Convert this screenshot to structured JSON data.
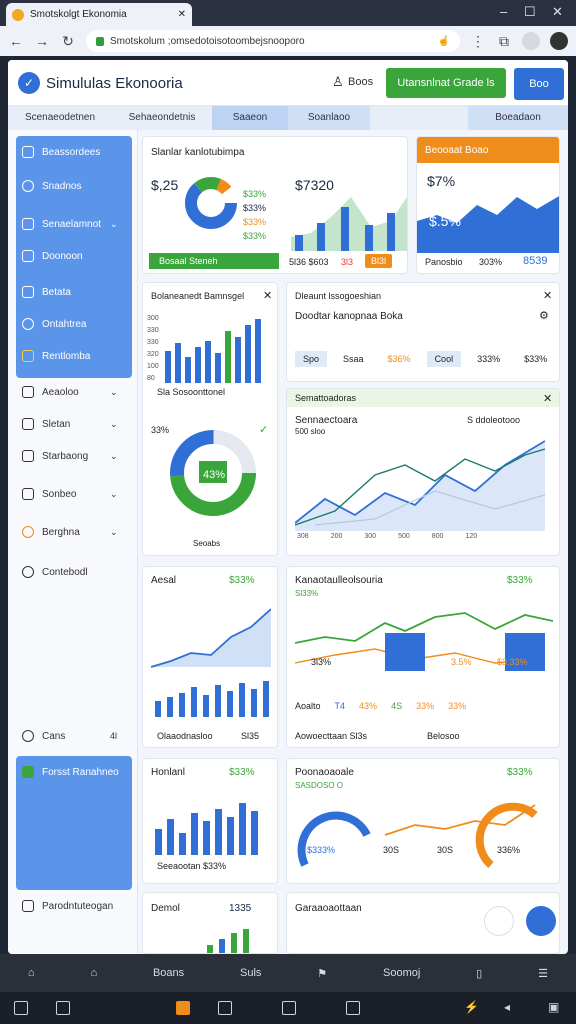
{
  "browser": {
    "tab_title": "Smotskolgt Ekonomia",
    "url": "Smotskolum ;omsedotoisotoombejsnooporo"
  },
  "app": {
    "title": "Simululas Ekonooria",
    "header_label": "Boos",
    "green_button": "Utansnlnat Grade ls",
    "blue_button": "Boo",
    "accent": "#2f6fd6",
    "green": "#3aa53a",
    "orange": "#f08c1a"
  },
  "subnav": [
    "Scenaeodetnen",
    "Sehaeondetnis",
    "Saaeon",
    "Soanlaoo",
    "",
    "Boeadaon"
  ],
  "sidebar": {
    "items": [
      "Beassordees",
      "Snadnos",
      "Senaelamnot",
      "Doonoon",
      "Betata",
      "Ontahtrea",
      "Rentlomba"
    ],
    "items2": [
      "Aeaoloo",
      "Sletan",
      "Starbaong",
      "Sonbeo",
      "Berghna",
      "Contebodl"
    ],
    "footer": "Cans",
    "footer_right": "4l",
    "panel2": "Forsst Ranahneo",
    "panel3": "Parodntuteogan"
  },
  "card1": {
    "title": "Slanlar kanlotubimpa",
    "v1": "$,25",
    "lines": [
      "$33%",
      "$33%",
      "$33%",
      "$33%"
    ],
    "v2": "$7320",
    "bar_label": "Bosaal Steneh",
    "foot1": "5l36 $603",
    "foot2": "3l3",
    "foot3": "Bl3l"
  },
  "card2": {
    "title": "Beooaat Boao",
    "v1": "$7%",
    "v2": "$.5%",
    "foot1": "Panosbio",
    "foot2": "303%",
    "foot3": "8539"
  },
  "card3": {
    "title": "Bolaneanedt Bamnsgel",
    "axis": [
      "300",
      "330",
      "330",
      "320",
      "100",
      "80"
    ],
    "foot": "Sla  Sosoonttonel",
    "pie_label": "33%",
    "center": "43%",
    "legend": "Seoabs"
  },
  "card4": {
    "title": "Dleaunt lssogoeshian",
    "sub": "Doodtar kanopnaa Boka",
    "chips": [
      "Spo",
      "Ssaa",
      "$36%",
      "Cool",
      "333%",
      "$33%"
    ]
  },
  "card5": {
    "title": "Semattoadoras",
    "line1": "Sennaectoara",
    "line2": "500 sloo",
    "pill": "S ddoleotooo",
    "axis": [
      "308",
      "200",
      "300",
      "500",
      "800",
      "120"
    ]
  },
  "card6": {
    "title": "Aesal",
    "v": "$33%",
    "foot": "Olaaodnasloo",
    "foot2": "Sl35"
  },
  "card7": {
    "title": "Kanaotaulleolsouria",
    "v": "$33%",
    "sub": "Sl33%",
    "lbl1": "3l3%",
    "lbl2": "3.5%",
    "lbl3": "$3.33%",
    "chips": [
      "Aoalto",
      "T4",
      "43%",
      "4S",
      "33%",
      "33%"
    ],
    "foot": "Aowoecttaan Sl3s",
    "foot2": "Belosoo"
  },
  "card8": {
    "title": "Honlanl",
    "v": "$33%",
    "foot": "Seeaootan  $33%"
  },
  "card9": {
    "title": "Poonaoaoale",
    "v": "$33%",
    "sub": "SASDOSO O",
    "l1": "$333%",
    "l2": "30S",
    "l3": "30S",
    "l4": "336%"
  },
  "card10": {
    "title": "Demol",
    "v": "1335"
  },
  "card11": {
    "title": "Garaaoaottaan"
  },
  "bottom": [
    "",
    "",
    "Boans",
    "Suls",
    "",
    "Soomoj",
    "",
    ""
  ]
}
